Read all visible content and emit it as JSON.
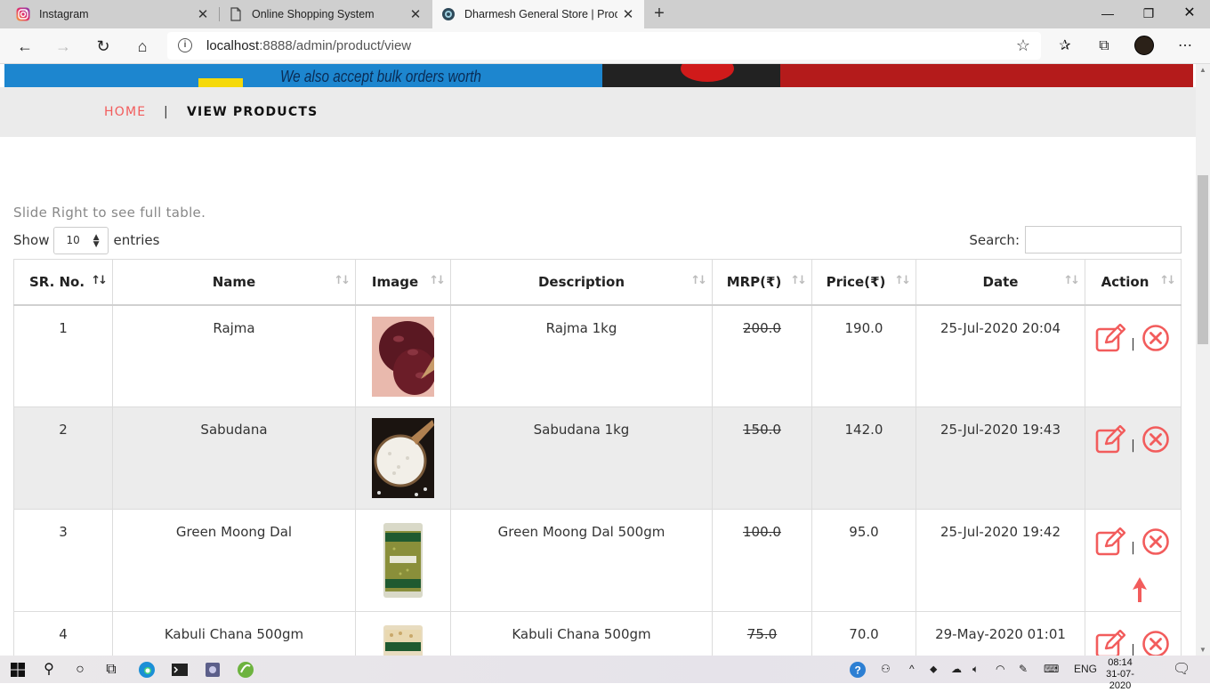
{
  "browser": {
    "tabs": [
      {
        "title": "Instagram",
        "icon": "instagram-icon"
      },
      {
        "title": "Online Shopping System",
        "icon": "page-icon"
      },
      {
        "title": "Dharmesh General Store | Produc",
        "icon": "store-icon"
      }
    ],
    "url_host": "localhost",
    "url_rest": ":8888/admin/product/view"
  },
  "banner": {
    "text": "We also accept bulk orders worth"
  },
  "breadcrumb": {
    "home": "HOME",
    "separator": "|",
    "current": "VIEW PRODUCTS"
  },
  "table_controls": {
    "hint": "Slide Right to see full table.",
    "show_label": "Show",
    "entries_value": "10",
    "entries_label": "entries",
    "search_label": "Search:"
  },
  "table": {
    "headers": [
      "SR. No.",
      "Name",
      "Image",
      "Description",
      "MRP(₹)",
      "Price(₹)",
      "Date",
      "Action"
    ],
    "rows": [
      {
        "sr": "1",
        "name": "Rajma",
        "description": "Rajma 1kg",
        "mrp": "200.0",
        "price": "190.0",
        "date": "25-Jul-2020 20:04",
        "image": "rajma-image"
      },
      {
        "sr": "2",
        "name": "Sabudana",
        "description": "Sabudana 1kg",
        "mrp": "150.0",
        "price": "142.0",
        "date": "25-Jul-2020 19:43",
        "image": "sabudana-image"
      },
      {
        "sr": "3",
        "name": "Green Moong Dal",
        "description": "Green Moong Dal 500gm",
        "mrp": "100.0",
        "price": "95.0",
        "date": "25-Jul-2020 19:42",
        "image": "moong-dal-image"
      },
      {
        "sr": "4",
        "name": "Kabuli Chana 500gm",
        "description": "Kabuli Chana 500gm",
        "mrp": "75.0",
        "price": "70.0",
        "date": "29-May-2020 01:01",
        "image": "kabuli-chana-image"
      }
    ],
    "action_separator": "|"
  },
  "colors": {
    "accent": "#f25c5c",
    "row_alt": "#ececec",
    "header_bg": "#ebebeb"
  },
  "taskbar": {
    "language": "ENG",
    "time": "08:14",
    "date": "31-07-2020"
  }
}
